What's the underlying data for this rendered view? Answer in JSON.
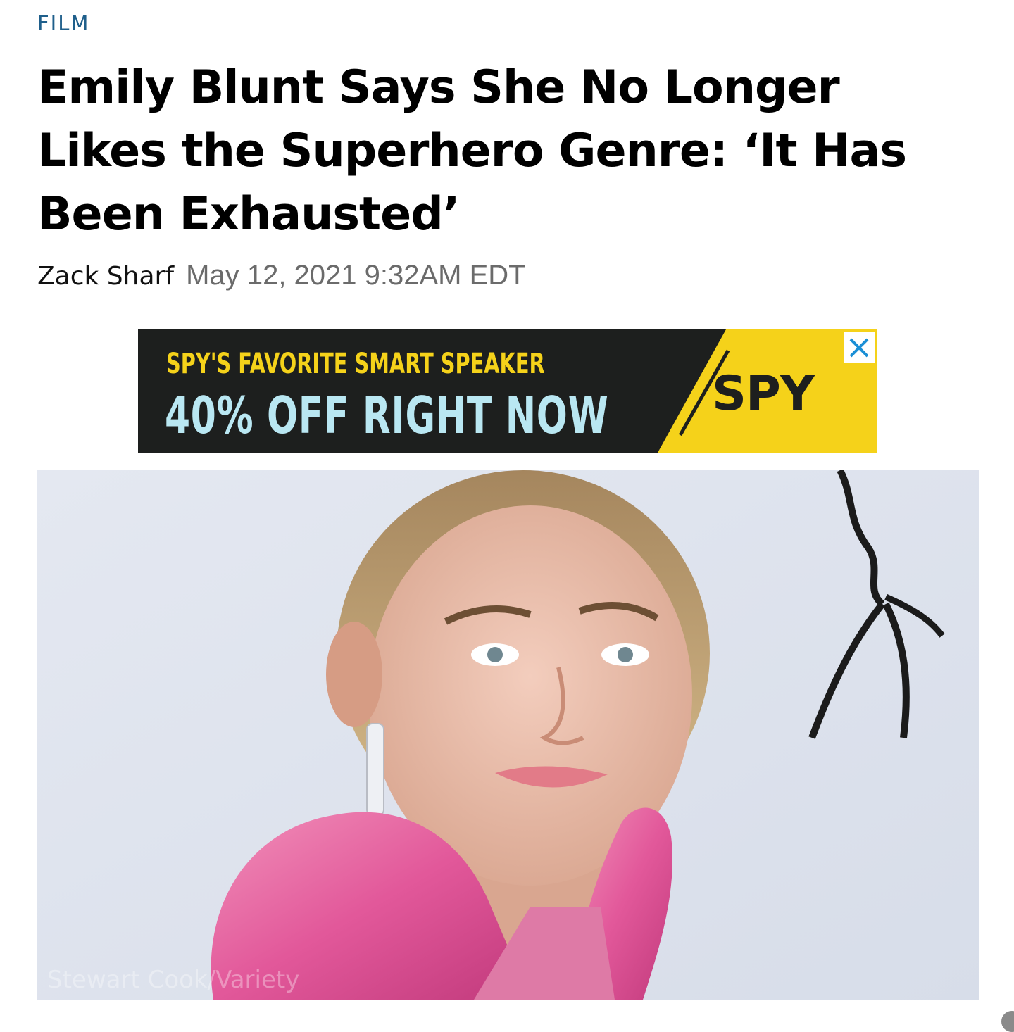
{
  "article": {
    "category": "FILM",
    "headline": "Emily Blunt Says She No Longer Likes the Superhero Genre: ‘It Has Been Exhausted’",
    "author": "Zack Sharf",
    "date": "May 12, 2021 9:32AM EDT"
  },
  "ad": {
    "line1": "SPY'S FAVORITE SMART SPEAKER",
    "line2": "40% OFF RIGHT NOW",
    "logo": "SPY",
    "close_icon": "close-icon",
    "colors": {
      "background": "#1d1f1e",
      "accent_yellow": "#f5d21a",
      "text_blue": "#b9e7f2"
    }
  },
  "photo": {
    "credit": "Stewart Cook/Variety"
  },
  "colors": {
    "category": "#1f5f8b",
    "date": "#6b6b6b"
  }
}
